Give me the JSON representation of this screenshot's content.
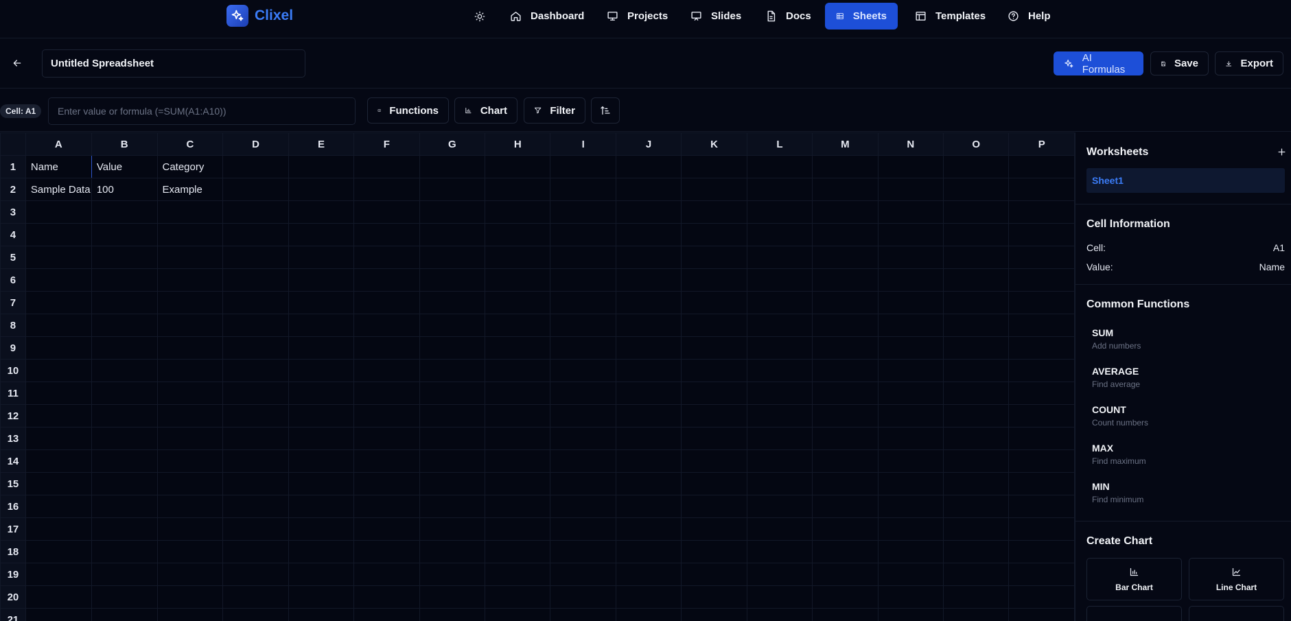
{
  "brand": {
    "name": "Clixel",
    "color": "#3b7cf7"
  },
  "nav": [
    {
      "label": "Dashboard",
      "icon": "home-icon"
    },
    {
      "label": "Projects",
      "icon": "presentation-icon"
    },
    {
      "label": "Slides",
      "icon": "monitor-icon"
    },
    {
      "label": "Docs",
      "icon": "document-icon"
    },
    {
      "label": "Sheets",
      "icon": "table-icon",
      "active": true
    },
    {
      "label": "Templates",
      "icon": "layout-icon"
    },
    {
      "label": "Help",
      "icon": "help-circle-icon"
    }
  ],
  "document": {
    "title": "Untitled Spreadsheet"
  },
  "actions": {
    "ai_formulas": "AI Formulas",
    "save": "Save",
    "export": "Export"
  },
  "formula_bar": {
    "cell_ref": "Cell: A1",
    "placeholder": "Enter value or formula (=SUM(A1:A10))",
    "value": ""
  },
  "tools": {
    "functions": "Functions",
    "chart": "Chart",
    "filter": "Filter"
  },
  "grid": {
    "columns": [
      "A",
      "B",
      "C",
      "D",
      "E",
      "F",
      "G",
      "H",
      "I",
      "J",
      "K",
      "L",
      "M",
      "N",
      "O",
      "P"
    ],
    "rows": [
      "1",
      "2",
      "3",
      "4",
      "5",
      "6",
      "7",
      "8",
      "9",
      "10",
      "11",
      "12",
      "13",
      "14",
      "15",
      "16",
      "17",
      "18",
      "19",
      "20",
      "21"
    ],
    "cells": [
      [
        "Name",
        "Value",
        "Category"
      ],
      [
        "Sample Data",
        "100",
        "Example"
      ]
    ],
    "selected": "A1"
  },
  "sidebar": {
    "worksheets_title": "Worksheets",
    "sheets": [
      "Sheet1"
    ],
    "cell_info_title": "Cell Information",
    "cell_label": "Cell:",
    "cell_value": "A1",
    "value_label": "Value:",
    "value_value": "Name",
    "functions_title": "Common Functions",
    "functions": [
      {
        "name": "SUM",
        "desc": "Add numbers"
      },
      {
        "name": "AVERAGE",
        "desc": "Find average"
      },
      {
        "name": "COUNT",
        "desc": "Count numbers"
      },
      {
        "name": "MAX",
        "desc": "Find maximum"
      },
      {
        "name": "MIN",
        "desc": "Find minimum"
      }
    ],
    "create_chart_title": "Create Chart",
    "charts": [
      {
        "label": "Bar Chart",
        "icon": "bar-chart-icon"
      },
      {
        "label": "Line Chart",
        "icon": "line-chart-icon"
      }
    ]
  },
  "colors": {
    "accent": "#1d4fd8",
    "background": "#050814"
  }
}
